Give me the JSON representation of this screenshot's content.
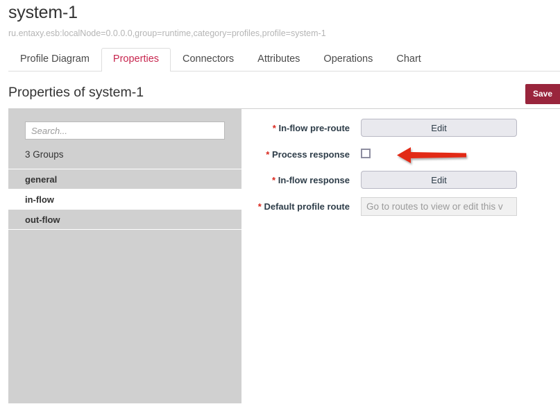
{
  "header": {
    "title": "system-1",
    "breadcrumb": "ru.entaxy.esb:localNode=0.0.0.0,group=runtime,category=profiles,profile=system-1"
  },
  "tabs": [
    {
      "label": "Profile Diagram",
      "active": false
    },
    {
      "label": "Properties",
      "active": true
    },
    {
      "label": "Connectors",
      "active": false
    },
    {
      "label": "Attributes",
      "active": false
    },
    {
      "label": "Operations",
      "active": false
    },
    {
      "label": "Chart",
      "active": false
    }
  ],
  "section": {
    "title": "Properties of system-1",
    "save_label": "Save"
  },
  "sidebar": {
    "search_placeholder": "Search...",
    "groups_count": "3 Groups",
    "groups": [
      {
        "label": "general",
        "selected": false
      },
      {
        "label": "in-flow",
        "selected": true
      },
      {
        "label": "out-flow",
        "selected": false
      }
    ]
  },
  "form": {
    "rows": [
      {
        "required": "*",
        "label": "In-flow pre-route",
        "control": "button",
        "value": "Edit"
      },
      {
        "required": "*",
        "label": "Process response",
        "control": "checkbox",
        "checked": false
      },
      {
        "required": "*",
        "label": "In-flow response",
        "control": "button",
        "value": "Edit"
      },
      {
        "required": "*",
        "label": "Default profile route",
        "control": "disabled-input",
        "value": "Go to routes to view or edit this v"
      }
    ]
  },
  "annotation": {
    "arrow_color": "#e22b18",
    "points_to": "process-response-checkbox"
  },
  "colors": {
    "accent": "#c7254e",
    "save_bg": "#99253c",
    "sidebar_bg": "#d0d0d0",
    "required": "#d9281e"
  }
}
